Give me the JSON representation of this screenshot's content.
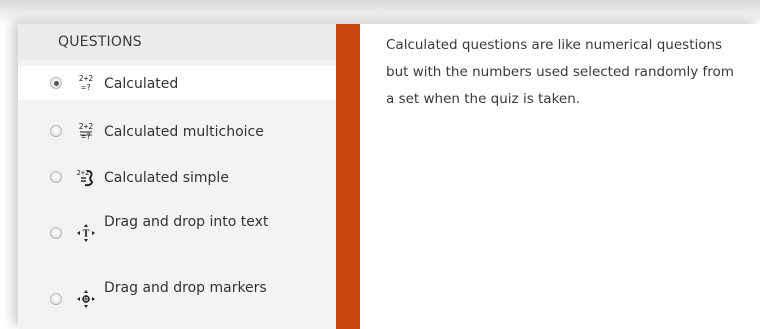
{
  "sidebar": {
    "heading": "QUESTIONS",
    "items": [
      {
        "label": "Calculated",
        "icon": "calculated-icon",
        "selected": true
      },
      {
        "label": "Calculated multichoice",
        "icon": "calculated-multichoice-icon",
        "selected": false
      },
      {
        "label": "Calculated simple",
        "icon": "calculated-simple-icon",
        "selected": false
      },
      {
        "label": "Drag and drop into text",
        "icon": "drag-drop-text-icon",
        "selected": false
      },
      {
        "label": "Drag and drop markers",
        "icon": "drag-drop-markers-icon",
        "selected": false
      }
    ]
  },
  "description": {
    "text": "Calculated questions are like numerical questions but with the numbers used selected randomly from a set when the quiz is taken."
  },
  "colors": {
    "accent_bar": "#c9470f",
    "sidebar_bg": "#f3f3f3",
    "selected_bg": "#ffffff"
  }
}
